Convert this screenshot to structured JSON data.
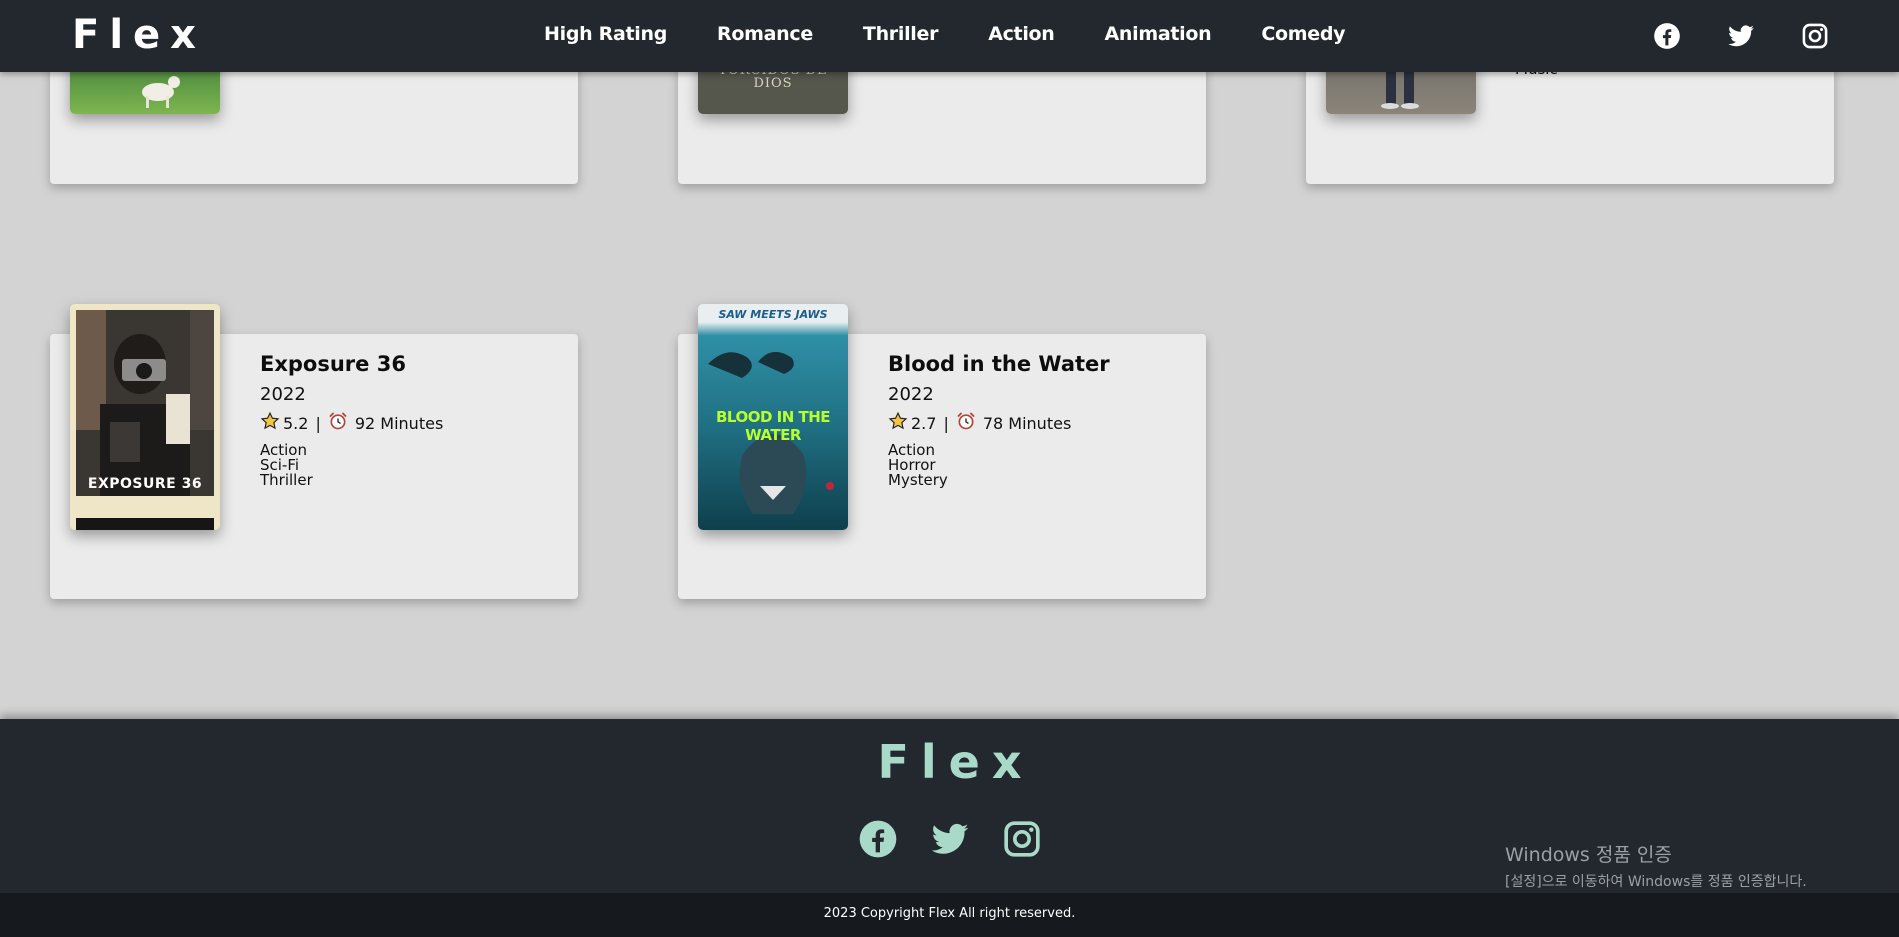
{
  "header": {
    "logo": "Flex",
    "nav": [
      "High Rating",
      "Romance",
      "Thriller",
      "Action",
      "Animation",
      "Comedy"
    ],
    "social_icons": [
      "facebook-icon",
      "twitter-icon",
      "instagram-icon"
    ]
  },
  "partial_cards": [
    {
      "genre_fragment": ""
    },
    {
      "poster_text": "TORCIDOS DE DIOS"
    },
    {
      "genre_fragment": "Music"
    }
  ],
  "movies": [
    {
      "title": "Exposure 36",
      "year": "2022",
      "rating": "5.2",
      "separator": "|",
      "duration": "92 Minutes",
      "genres": [
        "Action",
        "Sci-Fi",
        "Thriller"
      ],
      "poster_text": "EXPOSURE 36"
    },
    {
      "title": "Blood in the Water",
      "year": "2022",
      "rating": "2.7",
      "separator": "|",
      "duration": "78 Minutes",
      "genres": [
        "Action",
        "Horror",
        "Mystery"
      ],
      "poster_top": "SAW MEETS JAWS",
      "poster_text": "BLOOD IN THE WATER"
    }
  ],
  "footer": {
    "logo": "Flex",
    "copyright": "2023 Copyright Flex All right reserved."
  },
  "watermark": {
    "line1": "Windows 정품 인증",
    "line2": "[설정]으로 이동하여 Windows를 정품 인증합니다."
  },
  "colors": {
    "header_bg": "#23272e",
    "footer_accent": "#a9dac9",
    "page_bg": "#d3d3d3",
    "card_bg": "#ebebeb"
  }
}
